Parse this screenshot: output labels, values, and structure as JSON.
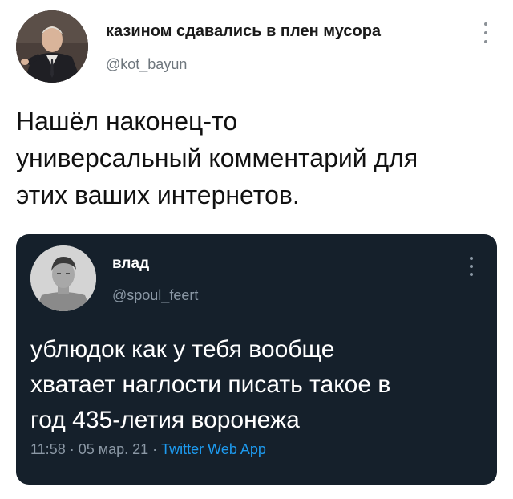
{
  "tweet": {
    "author": {
      "display_name": "казином сдавались в плен мусора",
      "handle": "@kot_bayun"
    },
    "more_icon": "more-vertical-icon",
    "text_lines": [
      "Нашёл наконец-то",
      "универсальный комментарий для",
      "этих ваших интернетов."
    ]
  },
  "quoted_tweet": {
    "author": {
      "display_name": "влад",
      "handle": "@spoul_feert"
    },
    "more_icon": "more-vertical-icon",
    "text_lines": [
      "ублюдок как у тебя вообще",
      "хватает наглости писать такое в",
      "год 435-летия воронежа"
    ],
    "time": "11:58",
    "separator": " · ",
    "date": "05 мар. 21",
    "app": "Twitter Web App"
  },
  "colors": {
    "card_background": "#15202b",
    "link_blue": "#1d9bf0",
    "secondary_text": "#6e767d"
  }
}
